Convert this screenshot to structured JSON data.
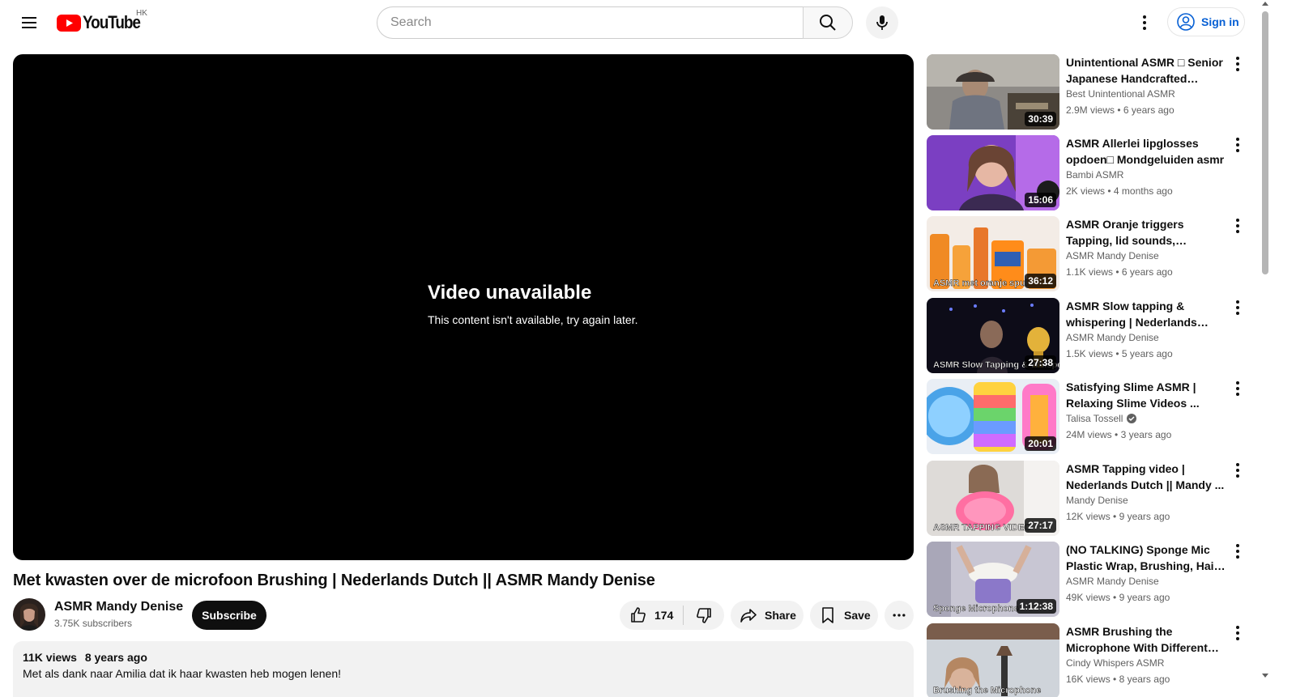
{
  "header": {
    "logo_text": "YouTube",
    "country_code": "HK",
    "search_placeholder": "Search",
    "signin_label": "Sign in",
    "icons": [
      "menu-icon",
      "search-icon",
      "microphone-icon",
      "more-vertical-icon",
      "account-icon"
    ]
  },
  "player": {
    "error_title": "Video unavailable",
    "error_subtitle": "This content isn't available, try again later."
  },
  "video": {
    "title": "Met kwasten over de microfoon Brushing | Nederlands Dutch || ASMR Mandy Denise",
    "channel_name": "ASMR Mandy Denise",
    "subscribers": "3.75K subscribers",
    "subscribe_label": "Subscribe",
    "like_count": "174",
    "share_label": "Share",
    "save_label": "Save",
    "views": "11K views",
    "age": "8 years ago",
    "description": "Met als dank naar Amilia dat ik haar kwasten heb mogen lenen!"
  },
  "related": [
    {
      "title": "Unintentional ASMR □ Senior Japanese Handcrafted Fountain Pen Making",
      "channel": "Best Unintentional ASMR",
      "verified": false,
      "views": "2.9M views",
      "age": "6 years ago",
      "duration": "30:39"
    },
    {
      "title": "ASMR Allerlei lipglosses opdoen□ Mondgeluiden asmr",
      "channel": "Bambi ASMR",
      "verified": false,
      "views": "2K views",
      "age": "4 months ago",
      "duration": "15:06"
    },
    {
      "title": "ASMR Oranje triggers Tapping, lid sounds, scratching □ | ...",
      "channel": "ASMR Mandy Denise",
      "verified": false,
      "views": "1.1K views",
      "age": "6 years ago",
      "duration": "36:12"
    },
    {
      "title": "ASMR Slow tapping & whispering | Nederlands Dutch ASMR",
      "channel": "ASMR Mandy Denise",
      "verified": false,
      "views": "1.5K views",
      "age": "5 years ago",
      "duration": "27:38"
    },
    {
      "title": "Satisfying Slime ASMR | Relaxing Slime Videos ...",
      "channel": "Talisa Tossell",
      "verified": true,
      "views": "24M views",
      "age": "3 years ago",
      "duration": "20:01"
    },
    {
      "title": "ASMR Tapping video | Nederlands Dutch  || Mandy ...",
      "channel": "Mandy Denise",
      "verified": false,
      "views": "12K views",
      "age": "9 years ago",
      "duration": "27:17"
    },
    {
      "title": "(NO TALKING) Sponge Mic Plastic Wrap, Brushing, Hair ...",
      "channel": "ASMR Mandy Denise",
      "verified": false,
      "views": "49K views",
      "age": "9 years ago",
      "duration": "1:12:38"
    },
    {
      "title": "ASMR Brushing the Microphone With Different Brushes | Met ...",
      "channel": "Cindy Whispers ASMR",
      "verified": false,
      "views": "16K views",
      "age": "8 years ago",
      "duration": ""
    }
  ],
  "thumb_captions": [
    "",
    "",
    "ASMR met oranje spul",
    "ASMR Slow Tapping & Whispering",
    "",
    "ASMR TAPPING VIDEO",
    "Sponge Microphone",
    "Brushing the Microphone"
  ],
  "colors": {
    "brand_red": "#ff0000",
    "link_blue": "#065fd4",
    "text": "#0f0f0f",
    "secondary": "#606060",
    "chip_bg": "#f2f2f2"
  }
}
